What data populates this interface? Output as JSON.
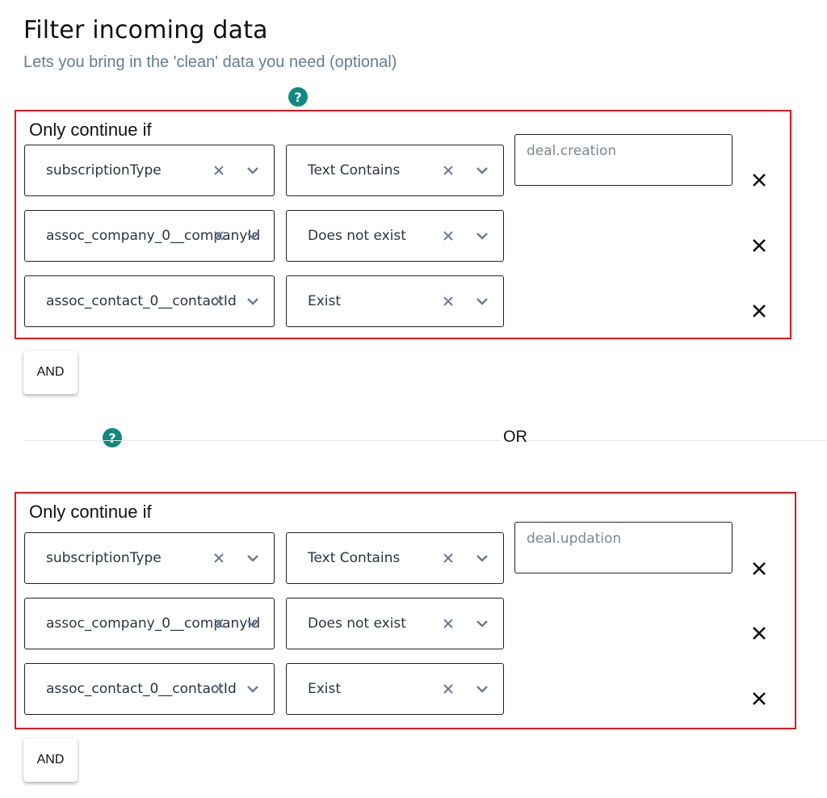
{
  "header": {
    "title": "Filter incoming data",
    "subtitle": "Lets you bring in the 'clean' data you need (optional)"
  },
  "icons": {
    "help": "question-circle-icon",
    "clear": "x-icon",
    "chevron": "chevron-down-icon",
    "remove": "close-icon"
  },
  "colors": {
    "group_border": "#e0171b",
    "help_icon": "#0f8a80",
    "subtitle": "#6b7a90"
  },
  "help_glyph": "?",
  "groups": [
    {
      "label": "Only continue if",
      "value_input": {
        "placeholder": "deal.creation"
      },
      "rows": [
        {
          "field": "subscriptionType",
          "operator": "Text Contains"
        },
        {
          "field": "assoc_company_0__companyId",
          "operator": "Does not exist"
        },
        {
          "field": "assoc_contact_0__contactId",
          "operator": "Exist"
        }
      ],
      "and_button": "AND"
    },
    {
      "label": "Only continue if",
      "value_input": {
        "placeholder": "deal.updation"
      },
      "rows": [
        {
          "field": "subscriptionType",
          "operator": "Text Contains"
        },
        {
          "field": "assoc_company_0__companyId",
          "operator": "Does not exist"
        },
        {
          "field": "assoc_contact_0__contactId",
          "operator": "Exist"
        }
      ],
      "and_button": "AND"
    }
  ],
  "or_label": "OR"
}
